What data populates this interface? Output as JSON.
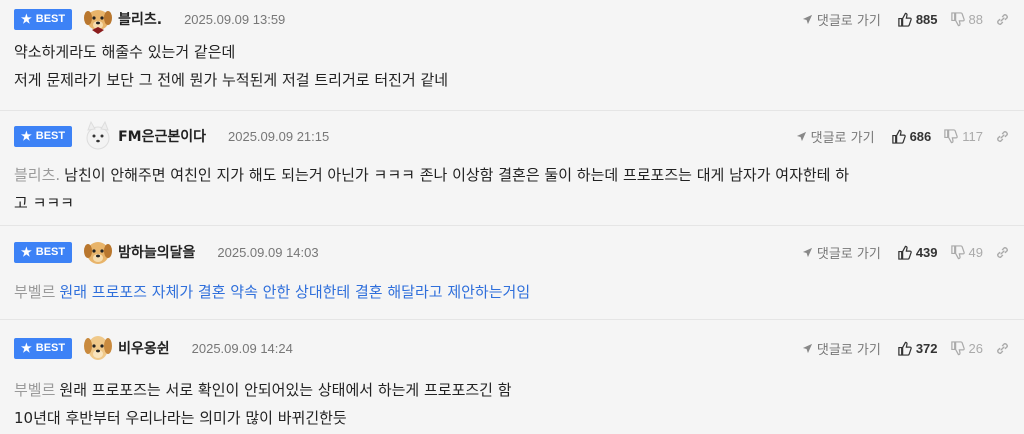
{
  "comments": [
    {
      "badge": "BEST",
      "nickname": "블리츠.",
      "date": "2025.09.09 13:59",
      "reply_label": "댓글로 가기",
      "likes": "885",
      "dislikes": "88",
      "mention": "",
      "lines": [
        "약소하게라도 해줄수 있는거 같은데",
        "저게 문제라기 보단 그 전에 뭔가 누적된게 저걸 트리거로 터진거 같네"
      ],
      "avatar": "puppy-icon"
    },
    {
      "badge": "BEST",
      "nickname": "FM은근본이다",
      "date": "2025.09.09 21:15",
      "reply_label": "댓글로 가기",
      "likes": "686",
      "dislikes": "117",
      "mention": "블리츠.",
      "lines": [
        "남친이 안해주면 여친인 지가 해도 되는거 아닌가 ㅋㅋㅋ 존나 이상함 결혼은 둘이 하는데 프로포즈는 대게 남자가 여자한테 하",
        "고 ㅋㅋㅋ"
      ],
      "avatar": "white-dog-icon"
    },
    {
      "badge": "BEST",
      "nickname": "밤하늘의달을",
      "date": "2025.09.09 14:03",
      "reply_label": "댓글로 가기",
      "likes": "439",
      "dislikes": "49",
      "mention": "부벨르",
      "lines": [
        "원래 프로포즈 자체가 결혼 약속 안한 상대한테 결혼 해달라고 제안하는거임"
      ],
      "avatar": "puppy-icon"
    },
    {
      "badge": "BEST",
      "nickname": "비우옹쉰",
      "date": "2025.09.09 14:24",
      "reply_label": "댓글로 가기",
      "likes": "372",
      "dislikes": "26",
      "mention": "부벨르",
      "lines": [
        "원래 프로포즈는 서로 확인이 안되어있는 상태에서 하는게 프로포즈긴 함",
        "10년대 후반부터 우리나라는 의미가 많이 바뀌긴한듯"
      ],
      "avatar": "puppy-icon"
    }
  ],
  "colors": {
    "badge": "#3d82f6",
    "mention": "#9a9a9a",
    "link_text": "#2f6fdb"
  }
}
